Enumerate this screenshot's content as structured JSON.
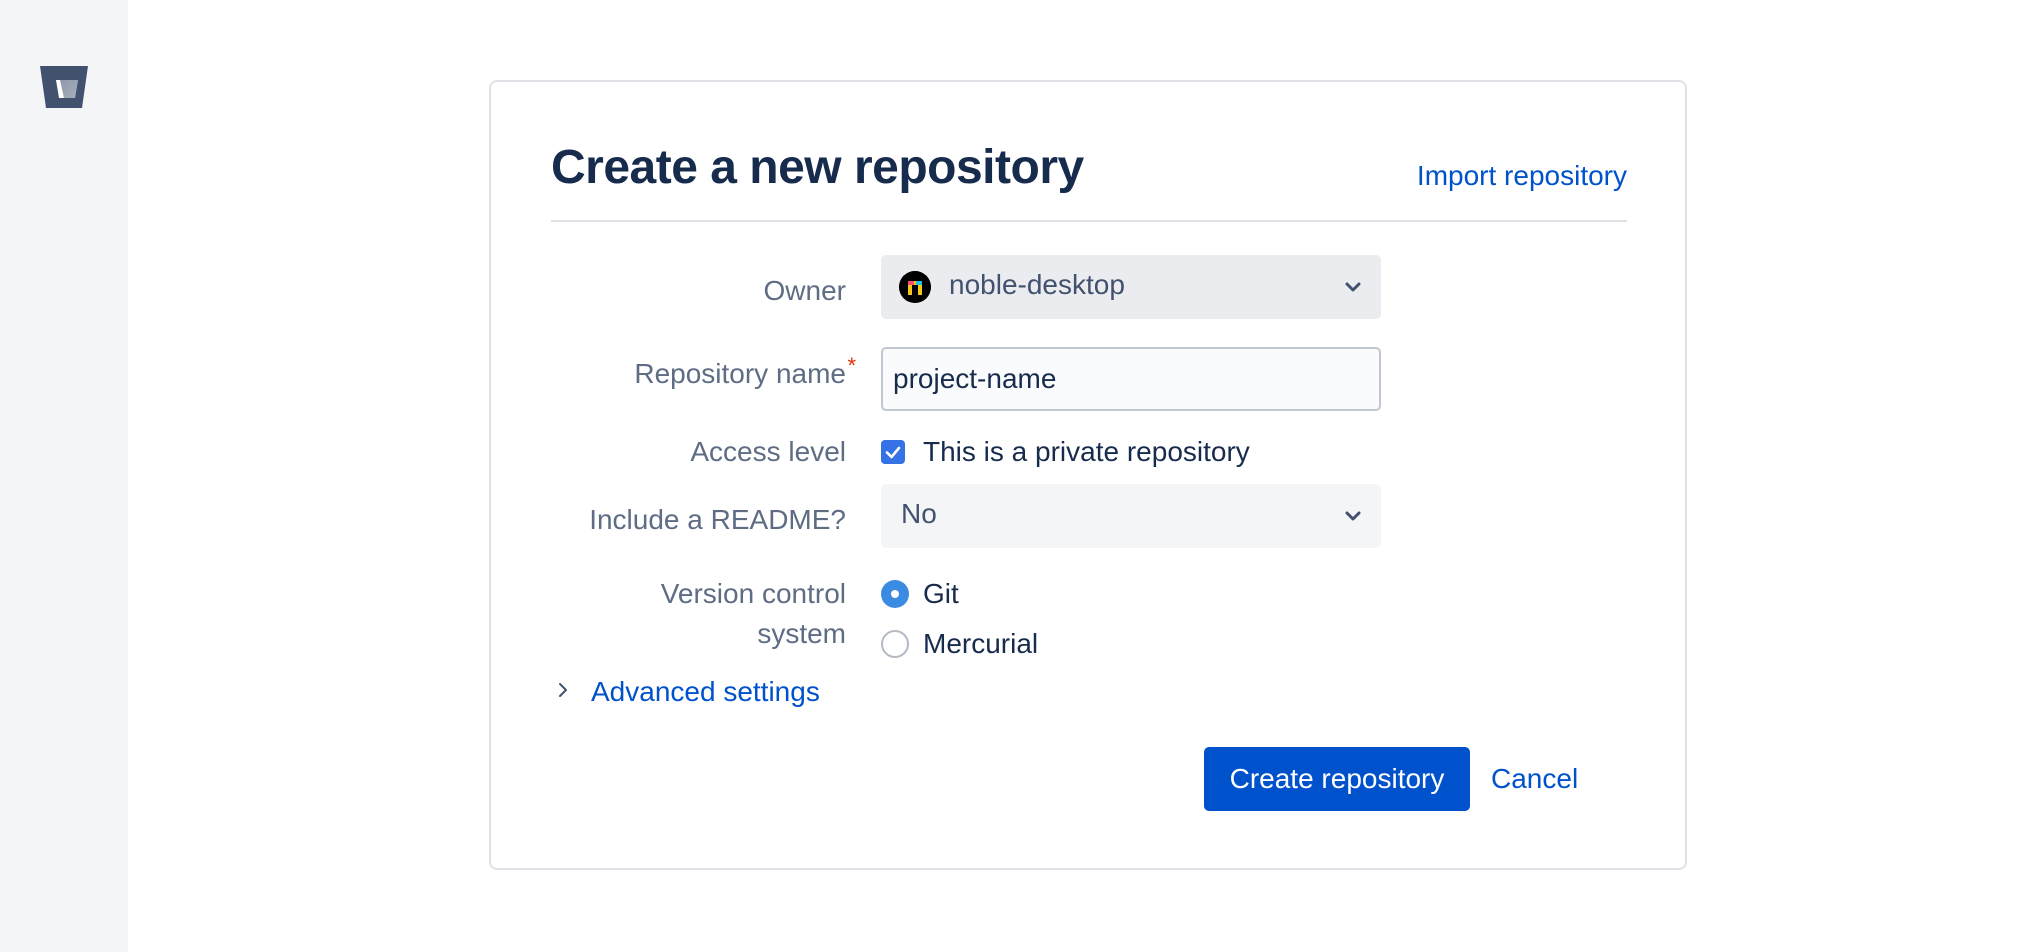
{
  "app": {
    "logo_icon": "bitbucket-logo-icon"
  },
  "header": {
    "title": "Create a new repository",
    "import_link": "Import repository"
  },
  "form": {
    "owner": {
      "label": "Owner",
      "value": "noble-desktop",
      "avatar_icon": "noble-desktop-avatar-icon"
    },
    "repository_name": {
      "label": "Repository name",
      "required_mark": "*",
      "value": "project-name"
    },
    "access_level": {
      "label": "Access level",
      "checkbox_label": "This is a private repository",
      "checked": true
    },
    "readme": {
      "label": "Include a README?",
      "value": "No"
    },
    "vcs": {
      "label_line1": "Version control",
      "label_line2": "system",
      "options": [
        {
          "label": "Git",
          "selected": true
        },
        {
          "label": "Mercurial",
          "selected": false
        }
      ]
    },
    "advanced_settings": "Advanced settings"
  },
  "actions": {
    "create_label": "Create repository",
    "cancel_label": "Cancel"
  },
  "colors": {
    "primary": "#0052cc",
    "heading": "#172b4d",
    "label": "#5e6c84",
    "required": "#de350b"
  }
}
